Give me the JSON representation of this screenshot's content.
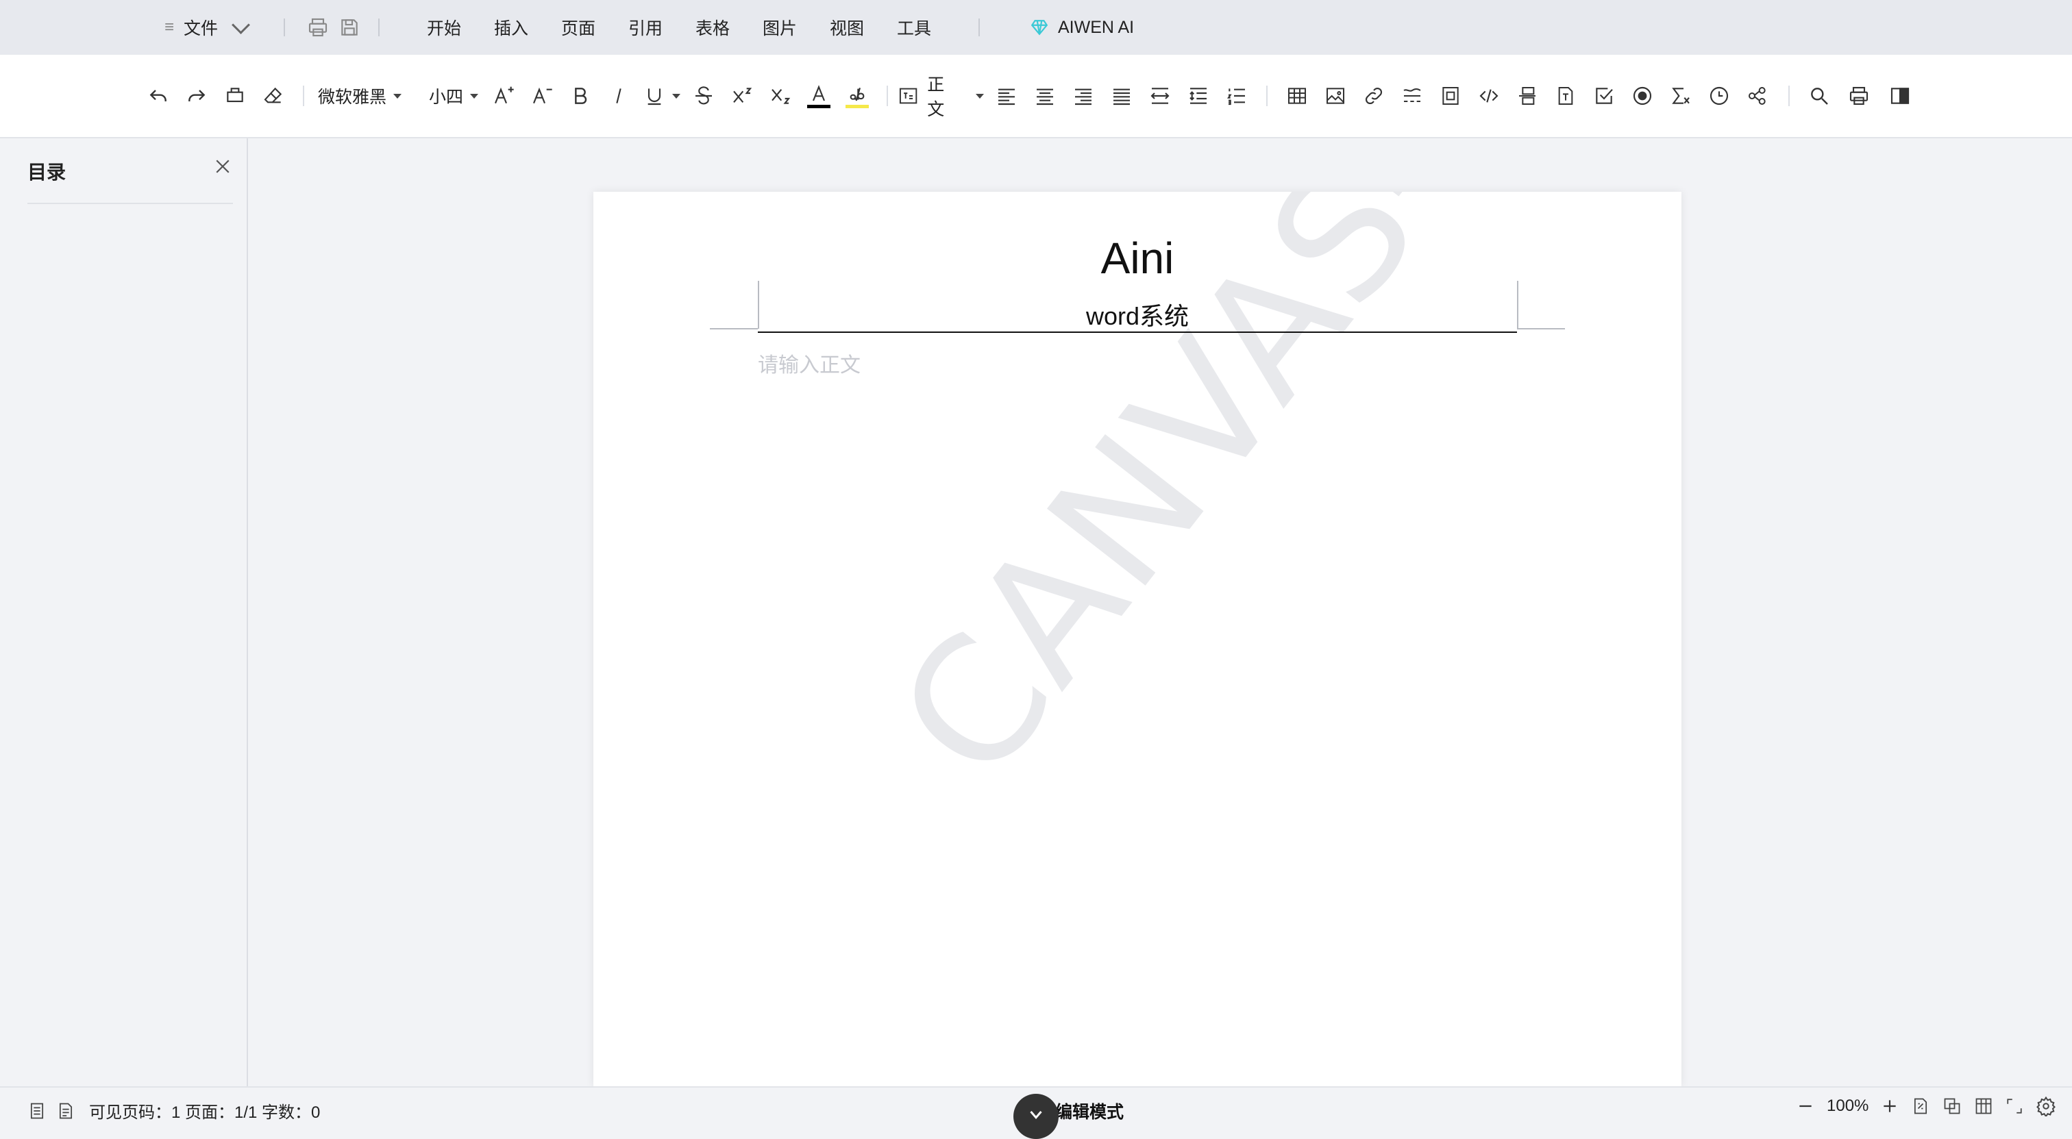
{
  "menubar": {
    "file_label": "文件",
    "tabs": [
      "开始",
      "插入",
      "页面",
      "引用",
      "表格",
      "图片",
      "视图",
      "工具"
    ],
    "ai_label": "AIWEN AI"
  },
  "toolbar": {
    "font_family": "微软雅黑",
    "font_size": "小四",
    "paragraph_style": "正文"
  },
  "sidebar": {
    "title": "目录"
  },
  "document": {
    "header_title": "Aini",
    "header_subtitle": "word系统",
    "body_placeholder": "请输入正文",
    "watermark": "CANVAS-EDITOR"
  },
  "statusbar": {
    "stats": "可见页码：1 页面：1/1 字数：0",
    "mode": "编辑模式",
    "zoom": "100%"
  },
  "colors": {
    "font_color_bar": "#000000",
    "highlight_bar": "#f5e94a",
    "ai_gem": "#3bc9d6"
  }
}
